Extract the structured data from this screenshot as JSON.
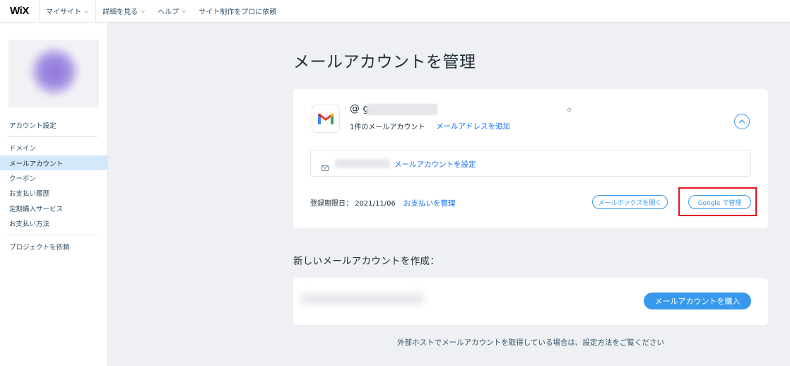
{
  "app": {
    "logo": "WiX"
  },
  "topnav": [
    {
      "label": "マイサイト",
      "dropdown": true
    },
    {
      "label": "詳細を見る",
      "dropdown": true
    },
    {
      "label": "ヘルプ",
      "dropdown": true
    },
    {
      "label": "サイト制作をプロに依頼",
      "dropdown": false
    }
  ],
  "sidebar": {
    "items": [
      {
        "label": "アカウント設定",
        "active": false
      },
      {
        "label": "ドメイン",
        "active": false
      },
      {
        "label": "メールアカウント",
        "active": true
      },
      {
        "label": "クーポン",
        "active": false
      },
      {
        "label": "お支払い履歴",
        "active": false
      },
      {
        "label": "定期購入サービス",
        "active": false
      },
      {
        "label": "お支払い方法",
        "active": false
      },
      {
        "label": "プロジェクトを依頼",
        "active": false
      }
    ]
  },
  "main": {
    "title": "メールアカウントを管理",
    "account": {
      "email_prefix": "@ g",
      "count_text": "1件のメールアカウント",
      "add_link": "メールアドレスを追加",
      "inbox_link": "メールアカウントを設定",
      "expiry_label": "登録期限日：",
      "expiry_date": "2021/11/06",
      "payment_link": "お支払いを管理",
      "open_mailbox_button": "メールボックスを開く",
      "google_manage_button": "Google で管理"
    },
    "create_title": "新しいメールアカウントを作成：",
    "buy_button": "メールアカウントを購入",
    "footer_note": "外部ホストでメールアカウントを取得している場合は、設定方法をご覧ください"
  },
  "colors": {
    "accent": "#3899ec",
    "link": "#116dff",
    "active_nav_bg": "#d3e8fb",
    "highlight": "#e5141e",
    "page_bg": "#eef0f3"
  },
  "icons": {
    "gmail": "gmail-logo-icon",
    "collapse": "chevron-up-icon",
    "mail": "envelope-icon",
    "dropdown": "chevron-down-icon"
  }
}
